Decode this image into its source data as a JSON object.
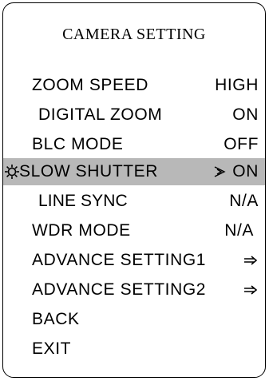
{
  "menu": {
    "title": "CAMERA SETTING",
    "items": [
      {
        "label": "ZOOM SPEED",
        "value": "HIGH"
      },
      {
        "label": "DIGITAL ZOOM",
        "value": "ON"
      },
      {
        "label": "BLC MODE",
        "value": "OFF"
      },
      {
        "label": "SLOW SHUTTER",
        "value": "ON",
        "selected": true
      },
      {
        "label": "LINE SYNC",
        "value": "N/A"
      },
      {
        "label": "WDR MODE",
        "value": "N/A"
      },
      {
        "label": "ADVANCE SETTING1",
        "icon": "right-arrow-icon"
      },
      {
        "label": "ADVANCE SETTING2",
        "icon": "right-arrow-icon"
      },
      {
        "label": "BACK"
      },
      {
        "label": "EXIT"
      }
    ]
  },
  "colors": {
    "selected_row_background": "#b8b8b8",
    "frame": "#000000",
    "text": "#000000"
  },
  "icons": {
    "selector": "gear-icon",
    "current_value_marker": "chevron-right-icon",
    "submenu": "right-arrow-icon"
  }
}
